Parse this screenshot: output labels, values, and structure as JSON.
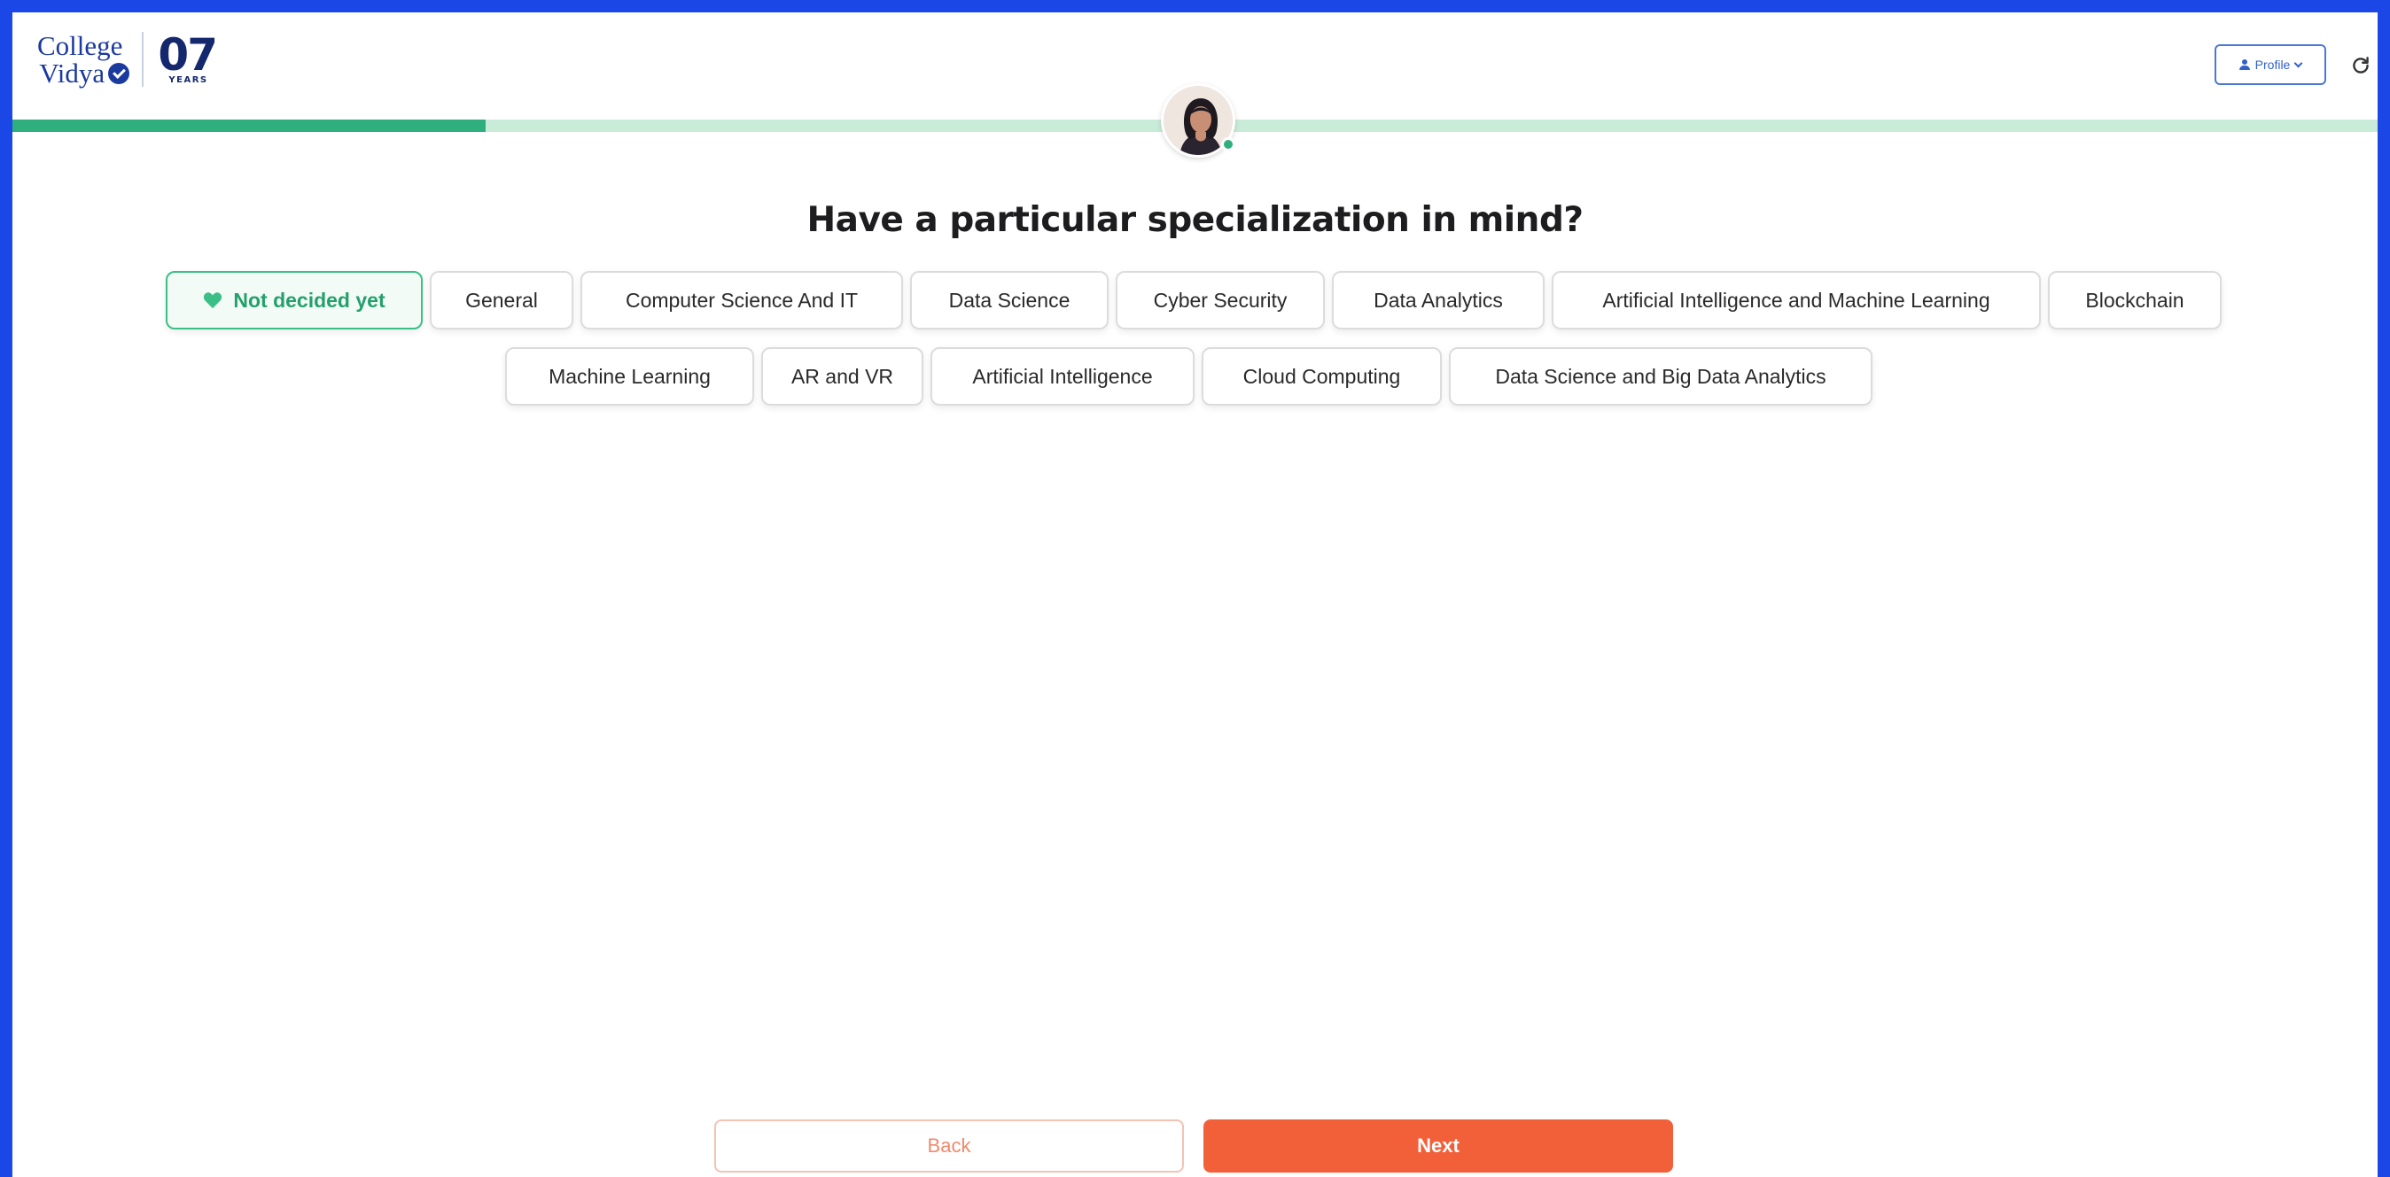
{
  "brand": {
    "line1": "College",
    "line2": "Vidya",
    "years_number": "07",
    "years_label": "YEARS"
  },
  "header": {
    "profile_label": "Profile"
  },
  "progress": {
    "fraction": 0.2
  },
  "question": "Have a particular specialization in mind?",
  "options": [
    {
      "label": "Not decided yet",
      "selected": true
    },
    {
      "label": "General"
    },
    {
      "label": "Computer Science And IT"
    },
    {
      "label": "Data Science"
    },
    {
      "label": "Cyber Security"
    },
    {
      "label": "Data Analytics"
    },
    {
      "label": "Artificial Intelligence and Machine Learning"
    },
    {
      "label": "Blockchain"
    },
    {
      "label": "Machine Learning"
    },
    {
      "label": "AR and VR"
    },
    {
      "label": "Artificial Intelligence"
    },
    {
      "label": "Cloud Computing"
    },
    {
      "label": "Data Science and Big Data Analytics"
    }
  ],
  "actions": {
    "back_label": "Back",
    "next_label": "Next"
  },
  "colors": {
    "accent_green": "#2eaf7d",
    "primary_orange": "#f2603a",
    "brand_blue": "#1b3a9e"
  }
}
